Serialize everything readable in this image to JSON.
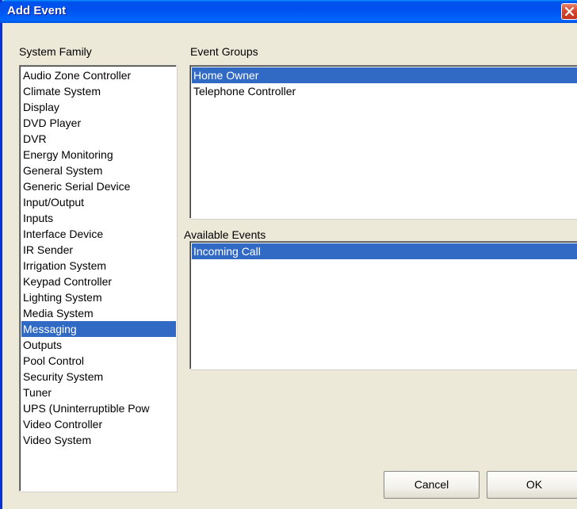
{
  "window": {
    "title": "Add Event"
  },
  "system_family": {
    "label": "System Family",
    "selected_index": 15,
    "items": [
      "Audio Zone Controller",
      "Climate System",
      "Display",
      "DVD Player",
      "DVR",
      "Energy Monitoring",
      "General System",
      "Generic Serial Device",
      "Input/Output",
      "Inputs",
      "Interface Device",
      "IR Sender",
      "Irrigation System",
      "Keypad Controller",
      "Lighting System",
      "Media System",
      "Messaging",
      "Outputs",
      "Pool Control",
      "Security System",
      "Tuner",
      "UPS (Uninterruptible Pow",
      "Video Controller",
      "Video System"
    ]
  },
  "event_groups": {
    "label": "Event Groups",
    "items": [
      "Home Owner",
      "Telephone Controller"
    ]
  },
  "available_events": {
    "label": "Available Events",
    "items": [
      "Incoming Call"
    ]
  },
  "buttons": {
    "cancel_label": "Cancel",
    "ok_label": "OK"
  },
  "colors": {
    "selection": "#316ac5",
    "dialog_background": "#ece9d8",
    "titlebar": "#0053ee"
  }
}
